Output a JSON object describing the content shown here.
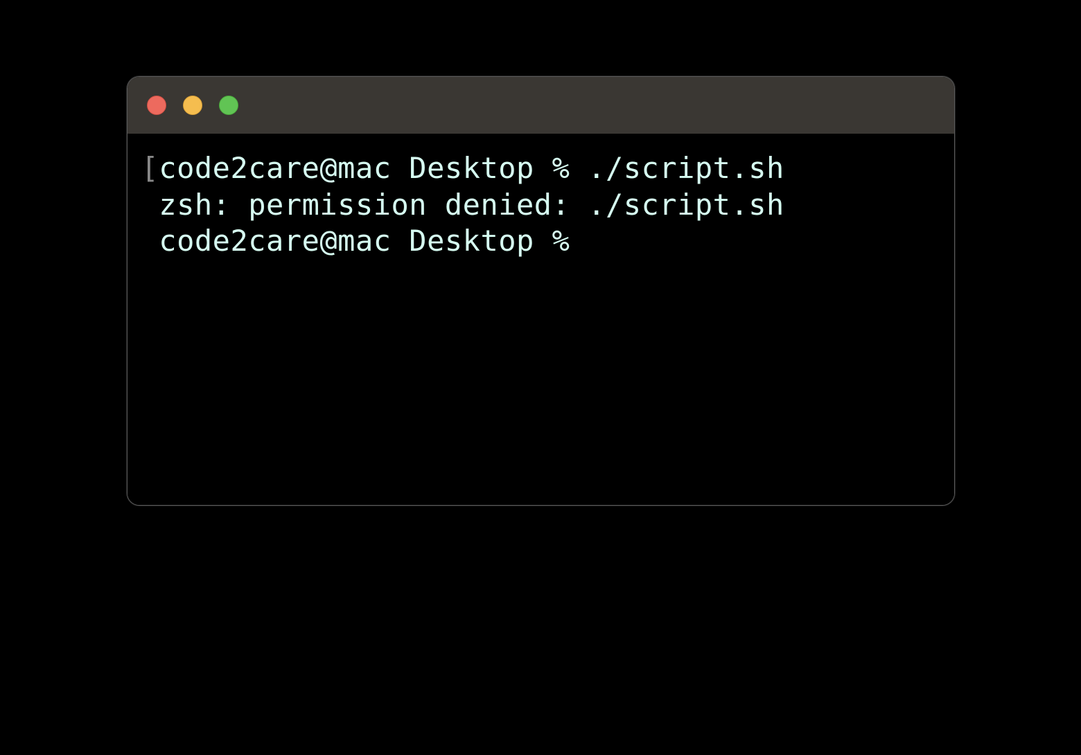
{
  "terminal": {
    "traffic_lights": {
      "close": "close-icon",
      "minimize": "minimize-icon",
      "maximize": "maximize-icon"
    },
    "lines": [
      {
        "bracket": "[",
        "prompt": "code2care@mac Desktop % ",
        "command": "./script.sh"
      },
      {
        "indent": " ",
        "output": "zsh: permission denied: ./script.sh"
      },
      {
        "indent": " ",
        "prompt": "code2care@mac Desktop % ",
        "command": ""
      }
    ]
  }
}
